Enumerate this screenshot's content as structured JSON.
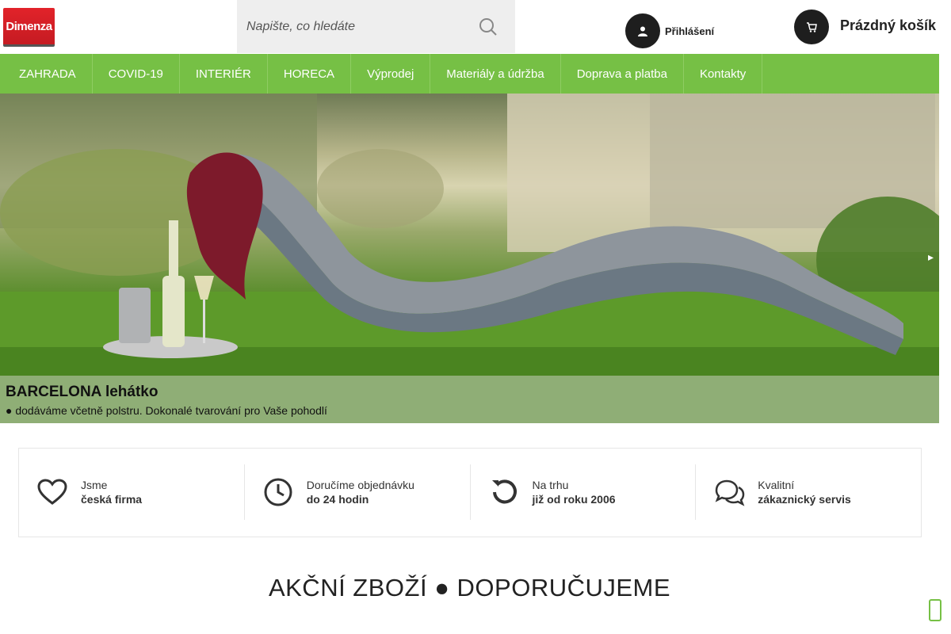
{
  "header": {
    "logo_text": "Dimenza",
    "search": {
      "placeholder": "Napište, co hledáte"
    },
    "login_label": "Přihlášení",
    "cart_label": "Prázdný košík"
  },
  "nav": {
    "items": [
      {
        "label": "ZAHRADA"
      },
      {
        "label": "COVID-19"
      },
      {
        "label": "INTERIÉR"
      },
      {
        "label": "HORECA"
      },
      {
        "label": "Výprodej"
      },
      {
        "label": "Materiály a údržba"
      },
      {
        "label": "Doprava a platba"
      },
      {
        "label": "Kontakty"
      }
    ]
  },
  "hero": {
    "title": "BARCELONA lehátko",
    "subtitle": "● dodáváme včetně polstru. Dokonalé tvarování pro Vaše pohodlí"
  },
  "features": [
    {
      "icon": "heart-icon",
      "line1": "Jsme",
      "line2": "česká firma"
    },
    {
      "icon": "clock-icon",
      "line1": "Doručíme objednávku",
      "line2": "do 24 hodin"
    },
    {
      "icon": "history-icon",
      "line1": "Na trhu",
      "line2": "již od roku 2006"
    },
    {
      "icon": "chat-icon",
      "line1": "Kvalitní",
      "line2": "zákaznický servis"
    }
  ],
  "section_heading": "AKČNÍ ZBOŽÍ ● DOPORUČUJEME",
  "colors": {
    "brand_red": "#e2232a",
    "nav_green": "#76c045"
  }
}
